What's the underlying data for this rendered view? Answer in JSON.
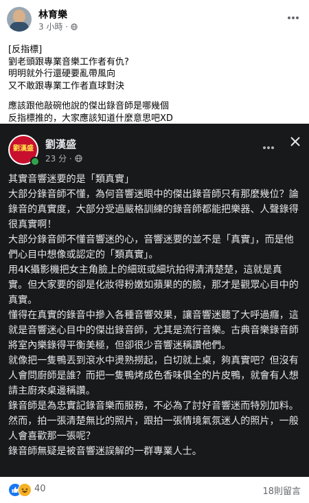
{
  "outer_post": {
    "author": "林育樂",
    "time": "3 小時",
    "lines": [
      "[反指標]",
      "劉老頭跟專業音樂工作者有仇?",
      "明明就外行還硬要亂帶風向",
      "又不敢跟專業工作者直球對決",
      "",
      "應該跟他敲碗他說的傑出錄音師是哪幾個",
      "反指標推的，大家應該知道什麼意思吧XD"
    ]
  },
  "shared_post": {
    "author": "劉漢盛",
    "time": "23 分",
    "avatar_text": "劉漢盛",
    "paragraphs": [
      "其實音響迷要的是「類真實」",
      "大部分錄音師不懂，為何音響迷眼中的傑出錄音師只有那麼幾位？論錄音的真實度，大部分受過嚴格訓練的錄音師都能把樂器、人聲錄得很真實啊！",
      "大部分錄音師不懂音響迷的心，音響迷要的並不是「真實」，而是他們心目中想像或認定的「類真實」。",
      "用4K攝影機把女主角臉上的細斑或細坑拍得清清楚楚，這就是真實。但大家要的卻是化妝得粉嫩如蘋果的的臉，那才是觀眾心目中的真實。",
      "懂得在真實的錄音中摻入各種音響效果，讓音響迷聽了大呼過癮，這就是音響迷心目中的傑出錄音師，尤其是流行音樂。古典音樂錄音師將室內樂錄得平衡美極，但卻很少音響迷稱讚他們。",
      "就像把一隻鴨丟到滾水中燙熟撈起，白切就上桌，夠真實吧？但沒有人會問廚師是誰？而把一隻鴨烤成色香味俱全的片皮鴨，就會有人想請主廚來桌邊稱讚。",
      "錄音師是為忠實記錄音樂而服務，不必為了討好音響迷而特別加料。然而，拍一張清楚無比的照片，跟拍一張情境氣氛迷人的照片，一般人會喜歡那一張呢？",
      "錄音師無疑是被音響迷誤解的一群專業人士。"
    ]
  },
  "footer": {
    "reaction_count": "40",
    "comment_count": "18則留言"
  },
  "icons": {
    "more": "more-dots-icon",
    "close": "close-icon",
    "public": "globe-icon",
    "reactions": [
      "like-icon",
      "haha-icon"
    ]
  },
  "colors": {
    "dark_card": "#18191a",
    "like": "#1877f2",
    "haha": "#f7b125",
    "online": "#31a24c"
  }
}
